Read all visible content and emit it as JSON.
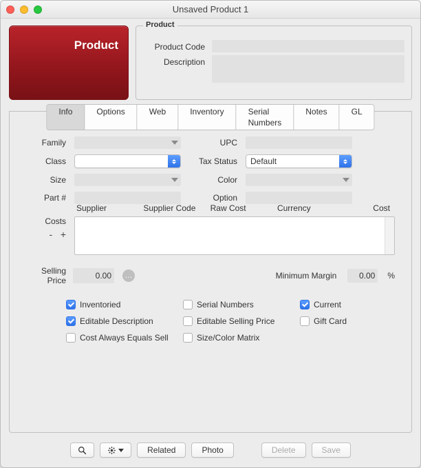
{
  "window": {
    "title": "Unsaved Product 1"
  },
  "tile": {
    "label": "Product"
  },
  "product_box": {
    "title": "Product",
    "code_label": "Product Code",
    "desc_label": "Description",
    "code_value": "",
    "desc_value": ""
  },
  "tabs": [
    "Info",
    "Options",
    "Web",
    "Inventory",
    "Serial Numbers",
    "Notes",
    "GL"
  ],
  "active_tab": "Info",
  "fields": {
    "family_label": "Family",
    "family_value": "",
    "upc_label": "UPC",
    "upc_value": "",
    "class_label": "Class",
    "class_value": "",
    "tax_status_label": "Tax Status",
    "tax_status_value": "Default",
    "size_label": "Size",
    "size_value": "",
    "color_label": "Color",
    "color_value": "",
    "part_label": "Part #",
    "part_value": "",
    "option_label": "Option",
    "option_value": ""
  },
  "costs": {
    "label": "Costs",
    "minus": "-",
    "plus": "+",
    "headers": [
      "Supplier",
      "Supplier Code",
      "Raw Cost",
      "Currency",
      "Cost"
    ]
  },
  "selling": {
    "label": "Selling Price",
    "value": "0.00",
    "min_margin_label": "Minimum Margin",
    "min_margin_value": "0.00",
    "pct": "%"
  },
  "checks": {
    "inventoried": {
      "label": "Inventoried",
      "checked": true
    },
    "serial_numbers": {
      "label": "Serial Numbers",
      "checked": false
    },
    "current": {
      "label": "Current",
      "checked": true
    },
    "editable_description": {
      "label": "Editable Description",
      "checked": true
    },
    "editable_selling_price": {
      "label": "Editable Selling Price",
      "checked": false
    },
    "gift_card": {
      "label": "Gift Card",
      "checked": false
    },
    "cost_always_equals_sell": {
      "label": "Cost Always Equals Sell",
      "checked": false
    },
    "size_color_matrix": {
      "label": "Size/Color Matrix",
      "checked": false
    }
  },
  "buttons": {
    "related": "Related",
    "photo": "Photo",
    "delete": "Delete",
    "save": "Save"
  },
  "icons": {
    "search": "search-icon",
    "gear": "gear-icon",
    "ellipsis": "…"
  }
}
